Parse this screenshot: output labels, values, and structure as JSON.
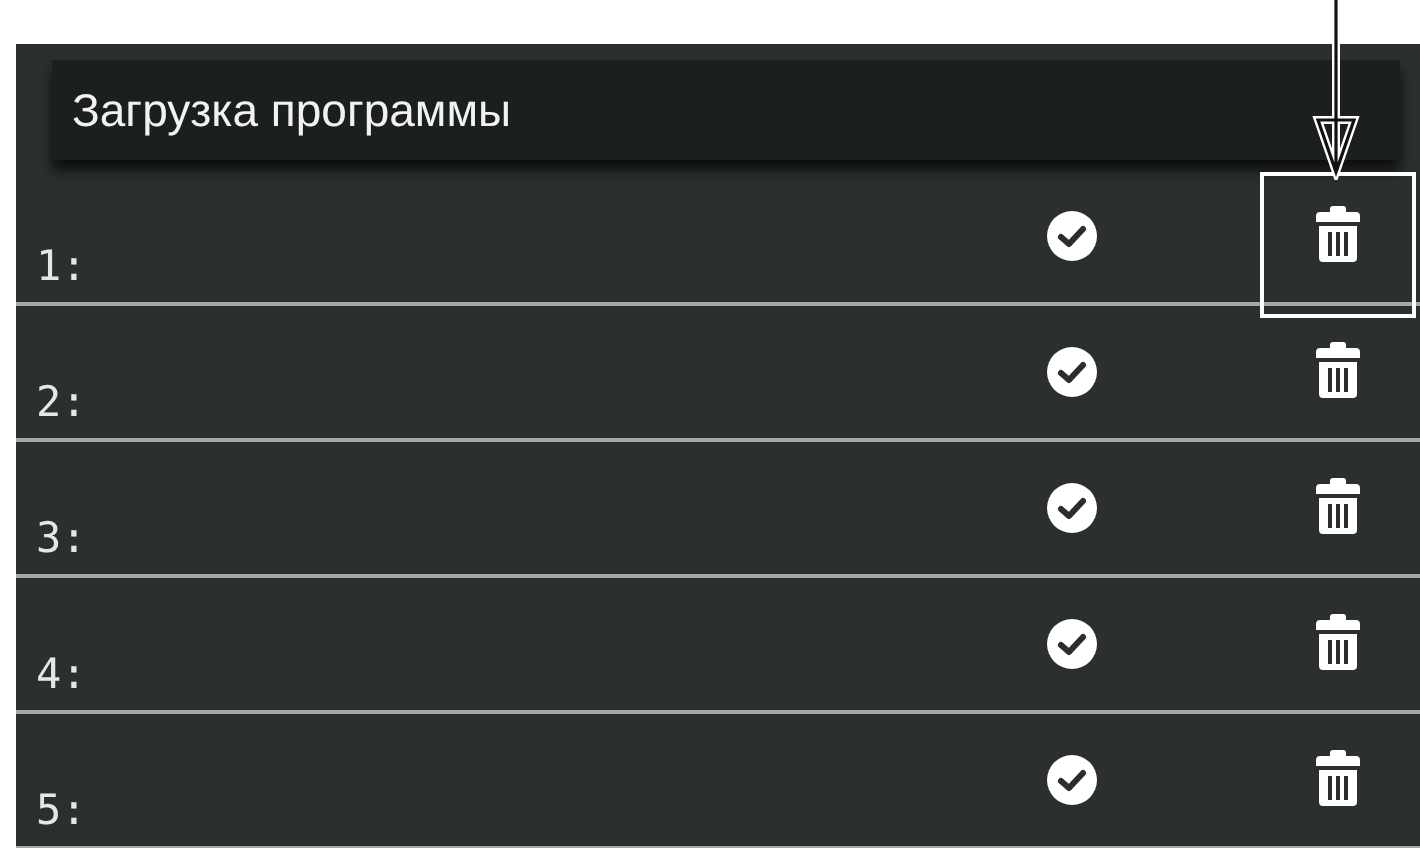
{
  "header": {
    "title": "Загрузка программы"
  },
  "rows": [
    {
      "number": "1:",
      "highlighted": true
    },
    {
      "number": "2:",
      "highlighted": false
    },
    {
      "number": "3:",
      "highlighted": false
    },
    {
      "number": "4:",
      "highlighted": false
    },
    {
      "number": "5:",
      "highlighted": false
    }
  ]
}
